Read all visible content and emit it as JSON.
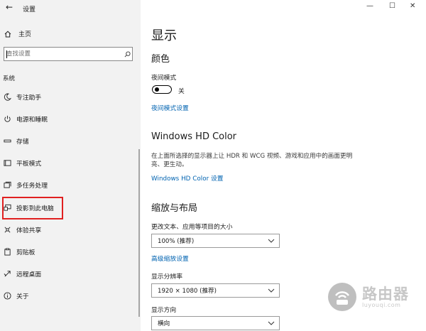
{
  "titlebar": {
    "back_glyph": "←",
    "title": "设置"
  },
  "window_controls": {
    "minimize": "—",
    "maximize": "☐",
    "close": "✕"
  },
  "sidebar": {
    "home_label": "主页",
    "search_placeholder": "查找设置",
    "section_label": "系统",
    "items": [
      {
        "label": "专注助手",
        "icon": "moon-icon"
      },
      {
        "label": "电源和睡眠",
        "icon": "power-icon"
      },
      {
        "label": "存储",
        "icon": "storage-icon"
      },
      {
        "label": "平板模式",
        "icon": "tablet-icon"
      },
      {
        "label": "多任务处理",
        "icon": "multitask-icon"
      },
      {
        "label": "投影到此电脑",
        "icon": "project-icon",
        "highlighted": true
      },
      {
        "label": "体验共享",
        "icon": "shared-experience-icon"
      },
      {
        "label": "剪贴板",
        "icon": "clipboard-icon"
      },
      {
        "label": "远程桌面",
        "icon": "remote-desktop-icon"
      },
      {
        "label": "关于",
        "icon": "info-icon"
      }
    ]
  },
  "main": {
    "title": "显示",
    "color_section": {
      "heading": "颜色",
      "night_light_label": "夜间模式",
      "night_light_state": "关",
      "night_light_link": "夜间模式设置"
    },
    "hdr_section": {
      "heading": "Windows HD Color",
      "description": "在上面所选择的显示器上让 HDR 和 WCG 视频、游戏和应用中的画面更明亮、更生动。",
      "link": "Windows HD Color 设置"
    },
    "scale_section": {
      "heading": "缩放与布局",
      "scale_label": "更改文本、应用等项目的大小",
      "scale_value": "100% (推荐)",
      "advanced_link": "高级缩放设置",
      "resolution_label": "显示分辨率",
      "resolution_value": "1920 × 1080 (推荐)",
      "orientation_label": "显示方向",
      "orientation_value": "横向"
    }
  },
  "watermark": {
    "name": "路由器",
    "domain": "luyouqi.com"
  }
}
